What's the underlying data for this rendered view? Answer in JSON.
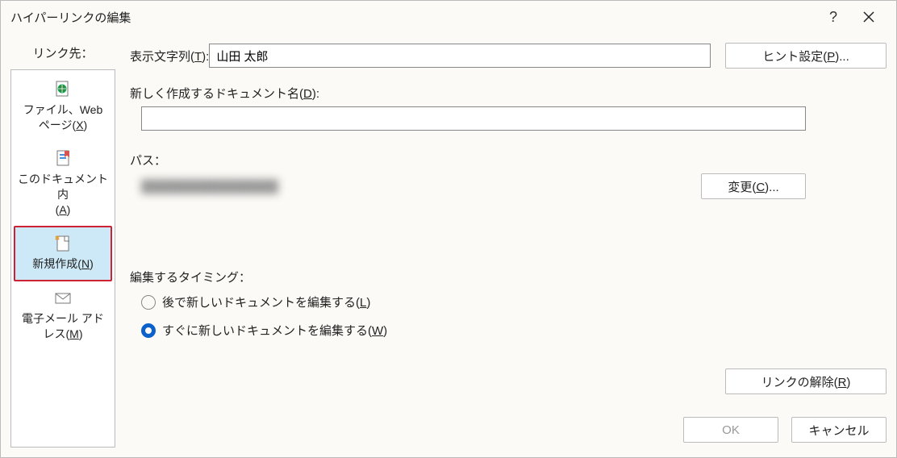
{
  "titlebar": {
    "title": "ハイパーリンクの編集"
  },
  "sidebar": {
    "label": "リンク先：",
    "items": [
      {
        "label_html": "ファイル、Web<br>ページ(<u>X</u>)"
      },
      {
        "label_html": "このドキュメント内<br>(<u>A</u>)"
      },
      {
        "label_html": "新規作成(<u>N</u>)"
      },
      {
        "label_html": "電子メール アド<br>レス(<u>M</u>)"
      }
    ],
    "selected_index": 2
  },
  "main": {
    "display_text_label_html": "表示文字列(<u>T</u>):",
    "display_text_value": "山田 太郎",
    "hint_button_html": "ヒント設定(<u>P</u>)...",
    "new_doc_label_html": "新しく作成するドキュメント名(<u>D</u>):",
    "new_doc_value": "",
    "path_label": "パス：",
    "path_value": "████████████████",
    "change_button_html": "変更(<u>C</u>)...",
    "timing_label": "編集するタイミング：",
    "radios": [
      {
        "label_html": "後で新しいドキュメントを編集する(<u>L</u>)"
      },
      {
        "label_html": "すぐに新しいドキュメントを編集する(<u>W</u>)"
      }
    ],
    "radio_selected_index": 1,
    "remove_link_html": "リンクの解除(<u>R</u>)",
    "ok_label": "OK",
    "cancel_label": "キャンセル"
  }
}
